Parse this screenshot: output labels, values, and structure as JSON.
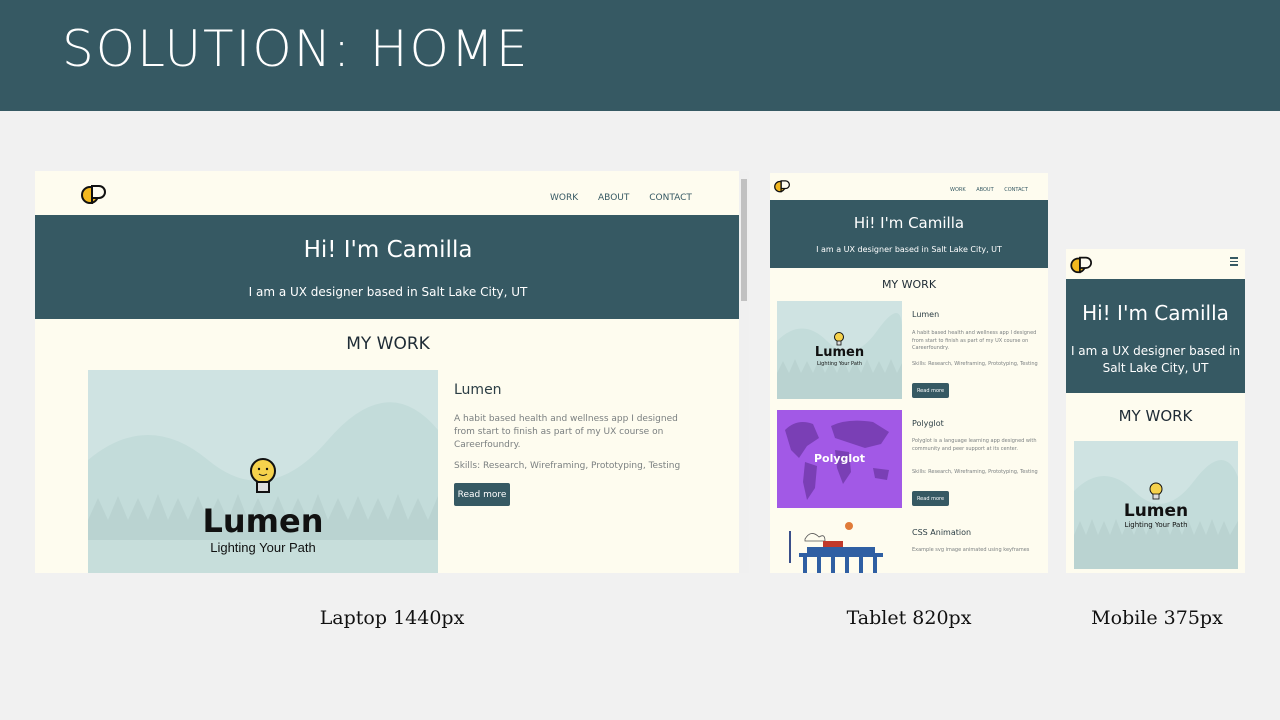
{
  "slide": {
    "title": "SOLUTION: HOME"
  },
  "nav": {
    "work": "WORK",
    "about": "ABOUT",
    "contact": "CONTACT"
  },
  "hero": {
    "heading": "Hi! I'm Camilla",
    "subheading": "I am a UX designer based in Salt Lake City, UT"
  },
  "my_work": {
    "title": "MY WORK"
  },
  "projects": [
    {
      "title": "Lumen",
      "description": "A habit based health and wellness app I designed from start to finish as part of my UX course on Careerfoundry.",
      "skills": "Skills: Research, Wireframing, Prototyping, Testing",
      "button": "Read more",
      "logo_text": "Lumen",
      "tagline": "Lighting Your Path"
    },
    {
      "title": "Polyglot",
      "description": "Polyglot is a language learning app designed with community and peer support at its center.",
      "skills": "Skills: Research, Wireframing, Prototyping, Testing",
      "button": "Read more",
      "logo_text": "Polyglot"
    },
    {
      "title": "CSS Animation",
      "description": "Example svg image animated using keyframes"
    }
  ],
  "captions": {
    "laptop": "Laptop 1440px",
    "tablet": "Tablet 820px",
    "mobile": "Mobile 375px"
  },
  "icons": {
    "logo": "cp-logo-icon",
    "menu": "hamburger-menu-icon",
    "bulb": "lightbulb-icon"
  },
  "colors": {
    "header": "#365963",
    "page_bg": "#fefcef",
    "slide_bg": "#f1f1f1"
  }
}
